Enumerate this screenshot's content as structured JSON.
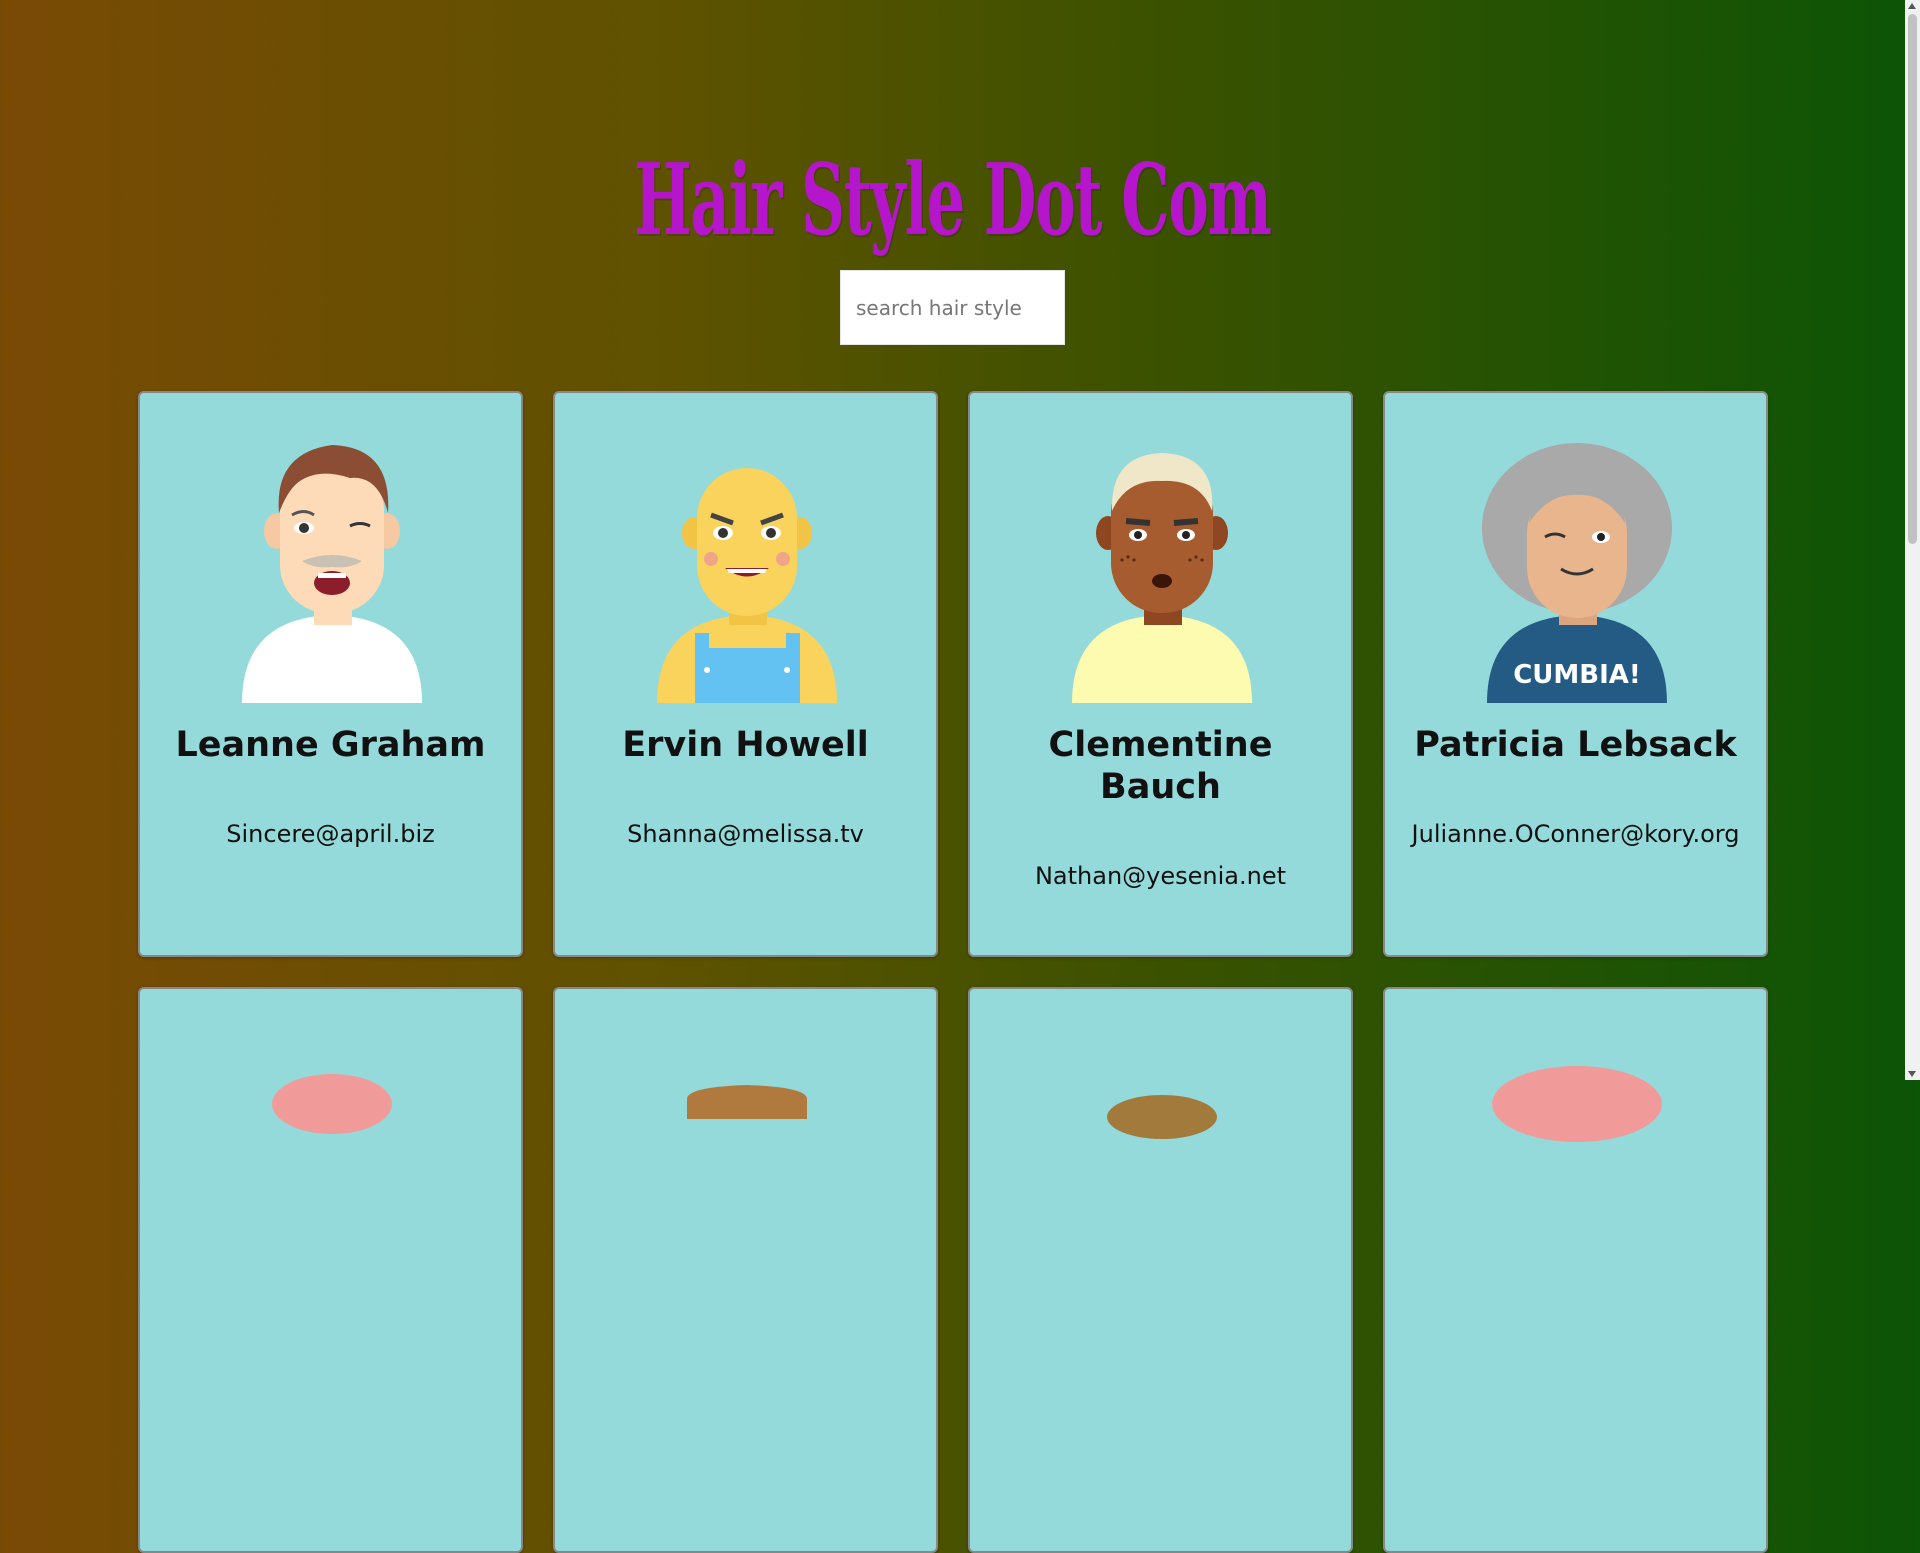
{
  "header": {
    "title": "Hair Style Dot Com"
  },
  "search": {
    "placeholder": "search hair style",
    "value": ""
  },
  "colors": {
    "title": "#b516cc",
    "card_background": "#95dada"
  },
  "cards": [
    {
      "name": "Leanne Graham",
      "email": "Sincere@april.biz",
      "avatar_icon": "man-avatar-icon"
    },
    {
      "name": "Ervin Howell",
      "email": "Shanna@melissa.tv",
      "avatar_icon": "bald-man-overalls-avatar-icon"
    },
    {
      "name": "Clementine Bauch",
      "email": "Nathan@yesenia.net",
      "avatar_icon": "white-haired-man-avatar-icon"
    },
    {
      "name": "Patricia Lebsack",
      "email": "Julianne.OConner@kory.org",
      "avatar_icon": "woman-grey-hair-avatar-icon",
      "shirt_text": "CUMBIA!"
    },
    {
      "name": "",
      "email": "",
      "avatar_icon": "pink-hair-avatar-icon"
    },
    {
      "name": "",
      "email": "",
      "avatar_icon": "brown-hair-avatar-icon"
    },
    {
      "name": "",
      "email": "",
      "avatar_icon": "brown-hair-avatar-icon"
    },
    {
      "name": "",
      "email": "",
      "avatar_icon": "pink-curly-hair-avatar-icon"
    }
  ]
}
